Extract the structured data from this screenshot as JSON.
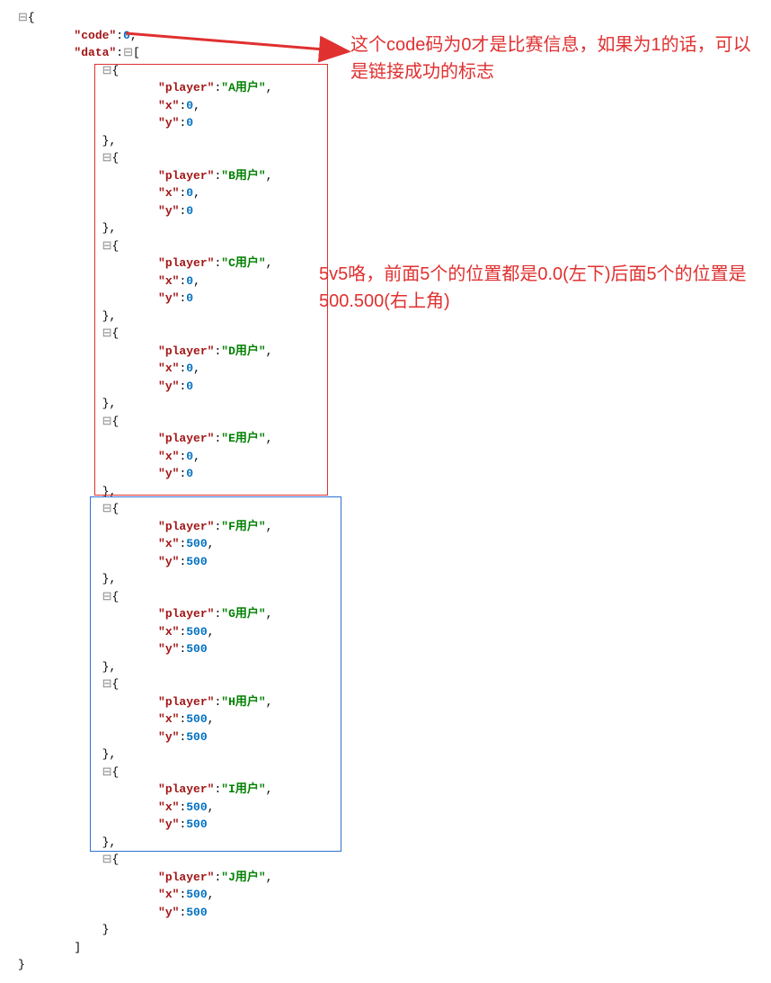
{
  "json": {
    "codeKey": "code",
    "codeVal": "0",
    "dataKey": "data",
    "playerKey": "player",
    "xKey": "x",
    "yKey": "y",
    "entries": [
      {
        "player": "A用户",
        "x": "0",
        "y": "0"
      },
      {
        "player": "B用户",
        "x": "0",
        "y": "0"
      },
      {
        "player": "C用户",
        "x": "0",
        "y": "0"
      },
      {
        "player": "D用户",
        "x": "0",
        "y": "0"
      },
      {
        "player": "E用户",
        "x": "0",
        "y": "0"
      },
      {
        "player": "F用户",
        "x": "500",
        "y": "500"
      },
      {
        "player": "G用户",
        "x": "500",
        "y": "500"
      },
      {
        "player": "H用户",
        "x": "500",
        "y": "500"
      },
      {
        "player": "I用户",
        "x": "500",
        "y": "500"
      },
      {
        "player": "J用户",
        "x": "500",
        "y": "500"
      }
    ]
  },
  "annotations": {
    "a1": "这个code码为0才是比赛信息，如果为1的话，可以是链接成功的标志",
    "a2": "5v5咯，前面5个的位置都是0.0(左下)后面5个的位置是500.500(右上角)"
  },
  "collapseIcon": "⊟"
}
